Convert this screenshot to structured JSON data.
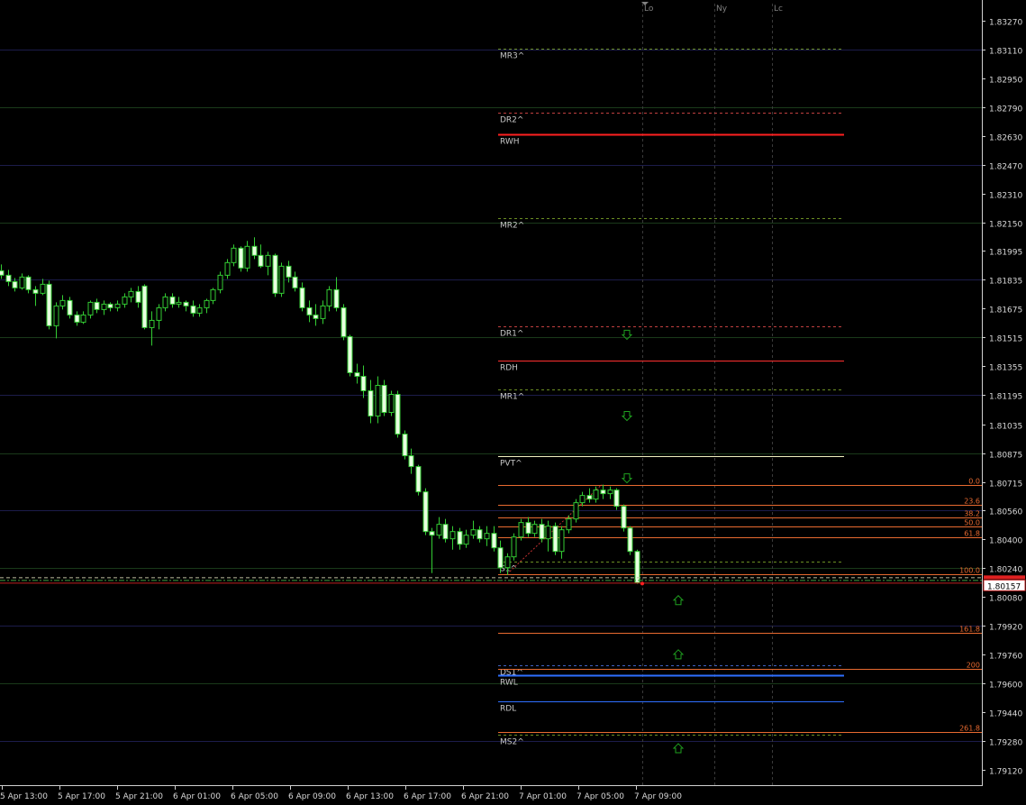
{
  "chart_data": {
    "type": "candlestick",
    "symbol_price_current": "1.80157",
    "y_axis": {
      "ylim": [
        1.79045,
        1.83325
      ],
      "tick_labels": [
        "1.83270",
        "1.83110",
        "1.82950",
        "1.82790",
        "1.82630",
        "1.82470",
        "1.82310",
        "1.82150",
        "1.81995",
        "1.81835",
        "1.81675",
        "1.81515",
        "1.81355",
        "1.81195",
        "1.81035",
        "1.80875",
        "1.80715",
        "1.80560",
        "1.80400",
        "1.80240",
        "1.80080",
        "1.79920",
        "1.79760",
        "1.79600",
        "1.79440",
        "1.79280",
        "1.79120"
      ]
    },
    "x_axis": {
      "tick_labels": [
        "5 Apr 13:00",
        "5 Apr 17:00",
        "5 Apr 21:00",
        "6 Apr 01:00",
        "6 Apr 05:00",
        "6 Apr 09:00",
        "6 Apr 13:00",
        "6 Apr 17:00",
        "6 Apr 21:00",
        "7 Apr 01:00",
        "7 Apr 05:00",
        "7 Apr 09:00"
      ]
    },
    "session_markers": [
      "Lo",
      "Ny",
      "Lc"
    ],
    "level_lines": [
      {
        "label": "MR3^",
        "price": 1.83115,
        "color": "#6b8e23",
        "style": "dashed"
      },
      {
        "label": "DR2^",
        "price": 1.8276,
        "color": "#c04040",
        "style": "dashed"
      },
      {
        "label": "RWH",
        "price": 1.8264,
        "color": "#ff2020",
        "style": "solid"
      },
      {
        "label": "MR2^",
        "price": 1.82175,
        "color": "#6b8e23",
        "style": "dashed"
      },
      {
        "label": "DR1^",
        "price": 1.81575,
        "color": "#c04040",
        "style": "dashed"
      },
      {
        "label": "RDH",
        "price": 1.81385,
        "color": "#ff3030",
        "style": "solid"
      },
      {
        "label": "MR1^",
        "price": 1.81225,
        "color": "#6b8e23",
        "style": "dashed"
      },
      {
        "label": "PVT^",
        "price": 1.8086,
        "color": "#f0f0c0",
        "style": "solid"
      },
      {
        "label": "S1^",
        "price": 1.80275,
        "color": "#6b8e23",
        "style": "dashed"
      },
      {
        "label": "DS1^",
        "price": 1.797,
        "color": "#4060c0",
        "style": "dashed"
      },
      {
        "label": "RWL",
        "price": 1.79645,
        "color": "#2e6fff",
        "style": "solid"
      },
      {
        "label": "RDL",
        "price": 1.795,
        "color": "#2e6fff",
        "style": "solid"
      },
      {
        "label": "MS2^",
        "price": 1.79315,
        "color": "#6b8e23",
        "style": "dashed"
      }
    ],
    "fib_levels": [
      {
        "label": "0.0",
        "price": 1.807
      },
      {
        "label": "23.6",
        "price": 1.8059
      },
      {
        "label": "38.2",
        "price": 1.8052
      },
      {
        "label": "50.0",
        "price": 1.8047
      },
      {
        "label": "61.8",
        "price": 1.8041
      },
      {
        "label": "100.0",
        "price": 1.80205
      },
      {
        "label": "161.8",
        "price": 1.7988
      },
      {
        "label": "200",
        "price": 1.7968
      },
      {
        "label": "261.8",
        "price": 1.7933
      }
    ],
    "signal_arrows": [
      {
        "dir": "down",
        "price": 1.8153
      },
      {
        "dir": "down",
        "price": 1.8108
      },
      {
        "dir": "down",
        "price": 1.80735
      },
      {
        "dir": "up",
        "price": 1.8006
      },
      {
        "dir": "up",
        "price": 1.7976
      },
      {
        "dir": "up",
        "price": 1.7924
      }
    ],
    "candles": [
      {
        "o": 1.81885,
        "h": 1.8192,
        "l": 1.8184,
        "c": 1.8186
      },
      {
        "o": 1.8186,
        "h": 1.8189,
        "l": 1.818,
        "c": 1.81825
      },
      {
        "o": 1.81825,
        "h": 1.81845,
        "l": 1.8177,
        "c": 1.8179
      },
      {
        "o": 1.8179,
        "h": 1.8187,
        "l": 1.8178,
        "c": 1.8185
      },
      {
        "o": 1.8185,
        "h": 1.8186,
        "l": 1.8176,
        "c": 1.8178
      },
      {
        "o": 1.8178,
        "h": 1.818,
        "l": 1.8169,
        "c": 1.8176
      },
      {
        "o": 1.8176,
        "h": 1.8184,
        "l": 1.8175,
        "c": 1.8181
      },
      {
        "o": 1.8181,
        "h": 1.8183,
        "l": 1.8156,
        "c": 1.8158
      },
      {
        "o": 1.8158,
        "h": 1.8171,
        "l": 1.8151,
        "c": 1.8169
      },
      {
        "o": 1.8169,
        "h": 1.8175,
        "l": 1.8167,
        "c": 1.8172
      },
      {
        "o": 1.8172,
        "h": 1.8174,
        "l": 1.8162,
        "c": 1.8164
      },
      {
        "o": 1.8164,
        "h": 1.8166,
        "l": 1.8158,
        "c": 1.816
      },
      {
        "o": 1.816,
        "h": 1.8166,
        "l": 1.8159,
        "c": 1.8164
      },
      {
        "o": 1.8164,
        "h": 1.8172,
        "l": 1.8162,
        "c": 1.8171
      },
      {
        "o": 1.8171,
        "h": 1.8173,
        "l": 1.8165,
        "c": 1.8167
      },
      {
        "o": 1.8167,
        "h": 1.8172,
        "l": 1.8164,
        "c": 1.817
      },
      {
        "o": 1.817,
        "h": 1.8171,
        "l": 1.8166,
        "c": 1.8168
      },
      {
        "o": 1.8168,
        "h": 1.8172,
        "l": 1.8166,
        "c": 1.817
      },
      {
        "o": 1.817,
        "h": 1.8176,
        "l": 1.8168,
        "c": 1.8174
      },
      {
        "o": 1.8174,
        "h": 1.8179,
        "l": 1.8171,
        "c": 1.8177
      },
      {
        "o": 1.8177,
        "h": 1.818,
        "l": 1.8168,
        "c": 1.8171
      },
      {
        "o": 1.818,
        "h": 1.8181,
        "l": 1.8156,
        "c": 1.8157
      },
      {
        "o": 1.8157,
        "h": 1.8166,
        "l": 1.8147,
        "c": 1.8161
      },
      {
        "o": 1.8161,
        "h": 1.817,
        "l": 1.8156,
        "c": 1.8168
      },
      {
        "o": 1.8168,
        "h": 1.8176,
        "l": 1.8166,
        "c": 1.8174
      },
      {
        "o": 1.8174,
        "h": 1.8176,
        "l": 1.8168,
        "c": 1.817
      },
      {
        "o": 1.817,
        "h": 1.8174,
        "l": 1.8168,
        "c": 1.8171
      },
      {
        "o": 1.8171,
        "h": 1.8172,
        "l": 1.8166,
        "c": 1.8169
      },
      {
        "o": 1.8169,
        "h": 1.8172,
        "l": 1.8163,
        "c": 1.8165
      },
      {
        "o": 1.8165,
        "h": 1.817,
        "l": 1.8163,
        "c": 1.8168
      },
      {
        "o": 1.8168,
        "h": 1.8173,
        "l": 1.8165,
        "c": 1.8172
      },
      {
        "o": 1.8172,
        "h": 1.8179,
        "l": 1.817,
        "c": 1.8178
      },
      {
        "o": 1.8178,
        "h": 1.8188,
        "l": 1.8176,
        "c": 1.8186
      },
      {
        "o": 1.8186,
        "h": 1.8195,
        "l": 1.8184,
        "c": 1.8193
      },
      {
        "o": 1.8193,
        "h": 1.8203,
        "l": 1.8191,
        "c": 1.8201
      },
      {
        "o": 1.8201,
        "h": 1.8202,
        "l": 1.8188,
        "c": 1.819
      },
      {
        "o": 1.819,
        "h": 1.8205,
        "l": 1.8188,
        "c": 1.8202
      },
      {
        "o": 1.8202,
        "h": 1.8207,
        "l": 1.8195,
        "c": 1.8197
      },
      {
        "o": 1.8197,
        "h": 1.8203,
        "l": 1.819,
        "c": 1.8191
      },
      {
        "o": 1.8191,
        "h": 1.8199,
        "l": 1.8186,
        "c": 1.8197
      },
      {
        "o": 1.8197,
        "h": 1.8198,
        "l": 1.8174,
        "c": 1.8176
      },
      {
        "o": 1.8176,
        "h": 1.8193,
        "l": 1.8174,
        "c": 1.8191
      },
      {
        "o": 1.8191,
        "h": 1.8194,
        "l": 1.8182,
        "c": 1.8185
      },
      {
        "o": 1.8185,
        "h": 1.8188,
        "l": 1.8177,
        "c": 1.8179
      },
      {
        "o": 1.8179,
        "h": 1.8182,
        "l": 1.8166,
        "c": 1.8168
      },
      {
        "o": 1.8168,
        "h": 1.8172,
        "l": 1.816,
        "c": 1.8164
      },
      {
        "o": 1.8164,
        "h": 1.817,
        "l": 1.8158,
        "c": 1.8162
      },
      {
        "o": 1.8162,
        "h": 1.8172,
        "l": 1.8159,
        "c": 1.8169
      },
      {
        "o": 1.8169,
        "h": 1.818,
        "l": 1.8166,
        "c": 1.8178
      },
      {
        "o": 1.8178,
        "h": 1.8185,
        "l": 1.8166,
        "c": 1.8168
      },
      {
        "o": 1.8168,
        "h": 1.817,
        "l": 1.815,
        "c": 1.8152
      },
      {
        "o": 1.8152,
        "h": 1.8153,
        "l": 1.813,
        "c": 1.8132
      },
      {
        "o": 1.8132,
        "h": 1.8137,
        "l": 1.8126,
        "c": 1.813
      },
      {
        "o": 1.813,
        "h": 1.8136,
        "l": 1.8118,
        "c": 1.8122
      },
      {
        "o": 1.8122,
        "h": 1.8128,
        "l": 1.8104,
        "c": 1.8108
      },
      {
        "o": 1.8108,
        "h": 1.813,
        "l": 1.8104,
        "c": 1.8125
      },
      {
        "o": 1.8125,
        "h": 1.8128,
        "l": 1.8108,
        "c": 1.811
      },
      {
        "o": 1.811,
        "h": 1.8122,
        "l": 1.8108,
        "c": 1.812
      },
      {
        "o": 1.812,
        "h": 1.8122,
        "l": 1.8096,
        "c": 1.8098
      },
      {
        "o": 1.8098,
        "h": 1.81,
        "l": 1.8084,
        "c": 1.8086
      },
      {
        "o": 1.8086,
        "h": 1.809,
        "l": 1.8076,
        "c": 1.808
      },
      {
        "o": 1.808,
        "h": 1.8081,
        "l": 1.8064,
        "c": 1.8066
      },
      {
        "o": 1.8066,
        "h": 1.8068,
        "l": 1.8042,
        "c": 1.8044
      },
      {
        "o": 1.8044,
        "h": 1.8046,
        "l": 1.8021,
        "c": 1.8042
      },
      {
        "o": 1.8042,
        "h": 1.8052,
        "l": 1.804,
        "c": 1.8048
      },
      {
        "o": 1.8048,
        "h": 1.8051,
        "l": 1.8038,
        "c": 1.804
      },
      {
        "o": 1.804,
        "h": 1.8047,
        "l": 1.8034,
        "c": 1.8044
      },
      {
        "o": 1.8044,
        "h": 1.8046,
        "l": 1.8034,
        "c": 1.8037
      },
      {
        "o": 1.8037,
        "h": 1.8045,
        "l": 1.8035,
        "c": 1.8042
      },
      {
        "o": 1.8042,
        "h": 1.805,
        "l": 1.804,
        "c": 1.8045
      },
      {
        "o": 1.8045,
        "h": 1.8047,
        "l": 1.8038,
        "c": 1.804
      },
      {
        "o": 1.804,
        "h": 1.8047,
        "l": 1.8036,
        "c": 1.8043
      },
      {
        "o": 1.8043,
        "h": 1.8047,
        "l": 1.8033,
        "c": 1.8035
      },
      {
        "o": 1.8035,
        "h": 1.8039,
        "l": 1.8021,
        "c": 1.8024
      },
      {
        "o": 1.8024,
        "h": 1.8032,
        "l": 1.802,
        "c": 1.803
      },
      {
        "o": 1.803,
        "h": 1.8043,
        "l": 1.8028,
        "c": 1.8041
      },
      {
        "o": 1.8041,
        "h": 1.8051,
        "l": 1.8039,
        "c": 1.8049
      },
      {
        "o": 1.8049,
        "h": 1.8052,
        "l": 1.8041,
        "c": 1.8043
      },
      {
        "o": 1.8043,
        "h": 1.805,
        "l": 1.8041,
        "c": 1.8048
      },
      {
        "o": 1.8048,
        "h": 1.8051,
        "l": 1.8038,
        "c": 1.804
      },
      {
        "o": 1.804,
        "h": 1.805,
        "l": 1.8033,
        "c": 1.8047
      },
      {
        "o": 1.8047,
        "h": 1.8049,
        "l": 1.8031,
        "c": 1.8033
      },
      {
        "o": 1.8033,
        "h": 1.8047,
        "l": 1.8029,
        "c": 1.8045
      },
      {
        "o": 1.8045,
        "h": 1.8053,
        "l": 1.8043,
        "c": 1.8051
      },
      {
        "o": 1.8051,
        "h": 1.8062,
        "l": 1.8049,
        "c": 1.806
      },
      {
        "o": 1.806,
        "h": 1.8066,
        "l": 1.8058,
        "c": 1.8064
      },
      {
        "o": 1.8064,
        "h": 1.8068,
        "l": 1.806,
        "c": 1.8062
      },
      {
        "o": 1.8062,
        "h": 1.8069,
        "l": 1.806,
        "c": 1.8067
      },
      {
        "o": 1.8067,
        "h": 1.807,
        "l": 1.8062,
        "c": 1.8065
      },
      {
        "o": 1.8065,
        "h": 1.8069,
        "l": 1.8062,
        "c": 1.8067
      },
      {
        "o": 1.8067,
        "h": 1.8068,
        "l": 1.8056,
        "c": 1.8058
      },
      {
        "o": 1.8058,
        "h": 1.8059,
        "l": 1.8044,
        "c": 1.8046
      },
      {
        "o": 1.8046,
        "h": 1.8047,
        "l": 1.8031,
        "c": 1.8033
      },
      {
        "o": 1.8033,
        "h": 1.8034,
        "l": 1.8015,
        "c": 1.80157
      }
    ]
  }
}
